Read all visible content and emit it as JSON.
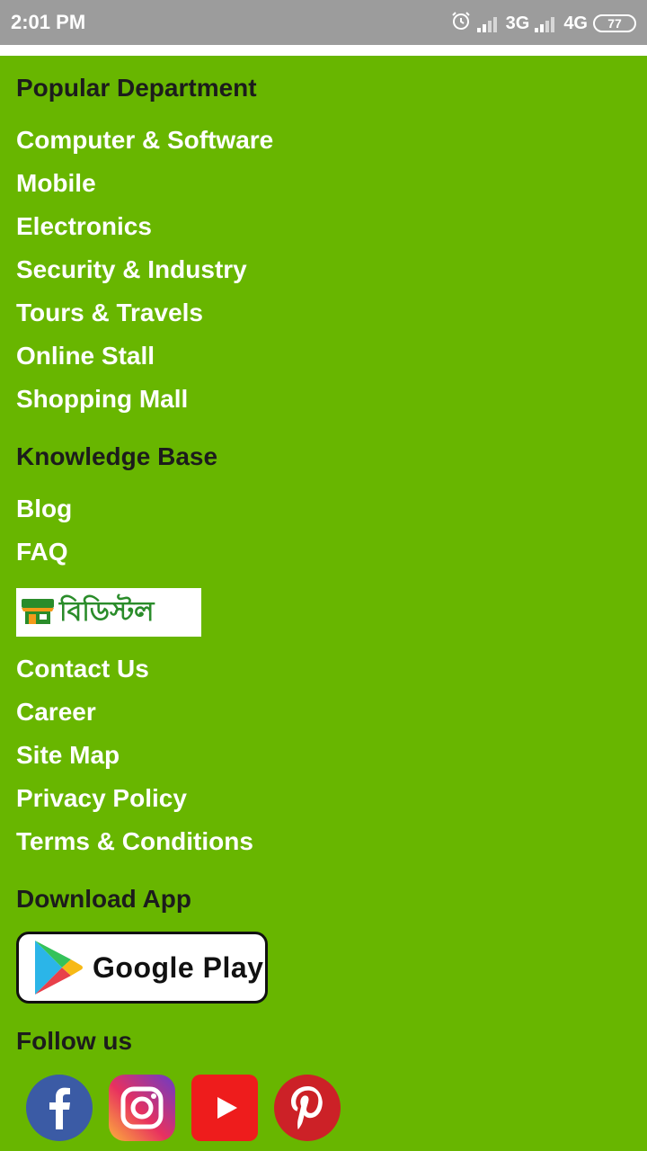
{
  "status_bar": {
    "time": "2:01 PM",
    "network_1": "3G",
    "network_2": "4G",
    "battery": "77"
  },
  "sections": {
    "popular": {
      "heading": "Popular Department",
      "links": [
        "Computer & Software",
        "Mobile",
        "Electronics",
        "Security & Industry",
        "Tours & Travels",
        "Online Stall",
        "Shopping Mall"
      ]
    },
    "knowledge": {
      "heading": "Knowledge Base",
      "links": [
        "Blog",
        "FAQ"
      ]
    },
    "company": {
      "logo_text": "বিডিস্টল",
      "links": [
        "Contact Us",
        "Career",
        "Site Map",
        "Privacy Policy",
        "Terms & Conditions"
      ]
    },
    "download": {
      "heading": "Download App",
      "store_label": "Google Play"
    },
    "follow": {
      "heading": "Follow us",
      "networks": [
        "facebook-icon",
        "instagram-icon",
        "youtube-icon",
        "pinterest-icon"
      ]
    }
  },
  "colors": {
    "background": "#68b600",
    "status_bar": "#9c9c9c",
    "heading": "#1c1c1c",
    "link": "#ffffff"
  }
}
